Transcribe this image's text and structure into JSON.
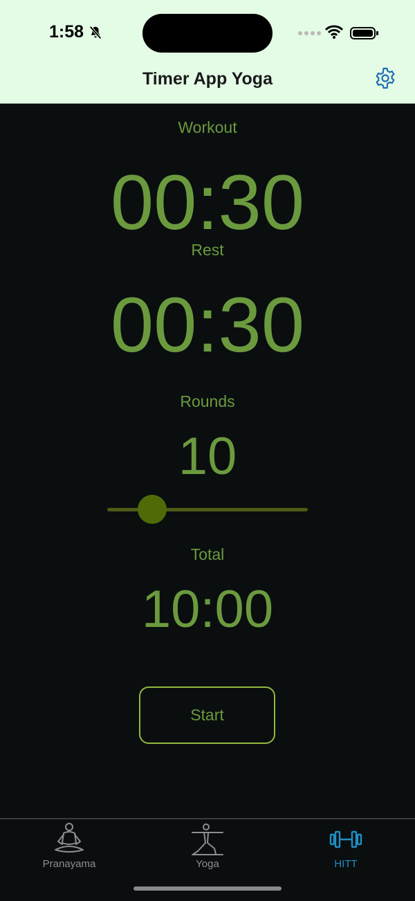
{
  "status_bar": {
    "time": "1:58",
    "icons": [
      "bell-slash-icon",
      "signal-dots-icon",
      "wifi-icon",
      "battery-icon"
    ]
  },
  "nav": {
    "title": "Timer App Yoga",
    "settings_icon": "gear-icon"
  },
  "timer": {
    "workout_label": "Workout",
    "workout_value": "00:30",
    "rest_label": "Rest",
    "rest_value": "00:30",
    "rounds_label": "Rounds",
    "rounds_value": "10",
    "slider_fraction": 0.2,
    "total_label": "Total",
    "total_value": "10:00",
    "start_label": "Start"
  },
  "tabs": [
    {
      "label": "Pranayama",
      "icon": "meditation-icon",
      "active": false
    },
    {
      "label": "Yoga",
      "icon": "yoga-pose-icon",
      "active": false
    },
    {
      "label": "HITT",
      "icon": "dumbbell-icon",
      "active": true
    }
  ],
  "colors": {
    "header_bg": "#e4fbe6",
    "background": "#0a0e0f",
    "accent_green": "#6b9a3e",
    "button_border": "#93b83c",
    "slider_thumb": "#4f6b07",
    "tab_active": "#1f8fc4",
    "tab_inactive": "#8e8e93"
  }
}
